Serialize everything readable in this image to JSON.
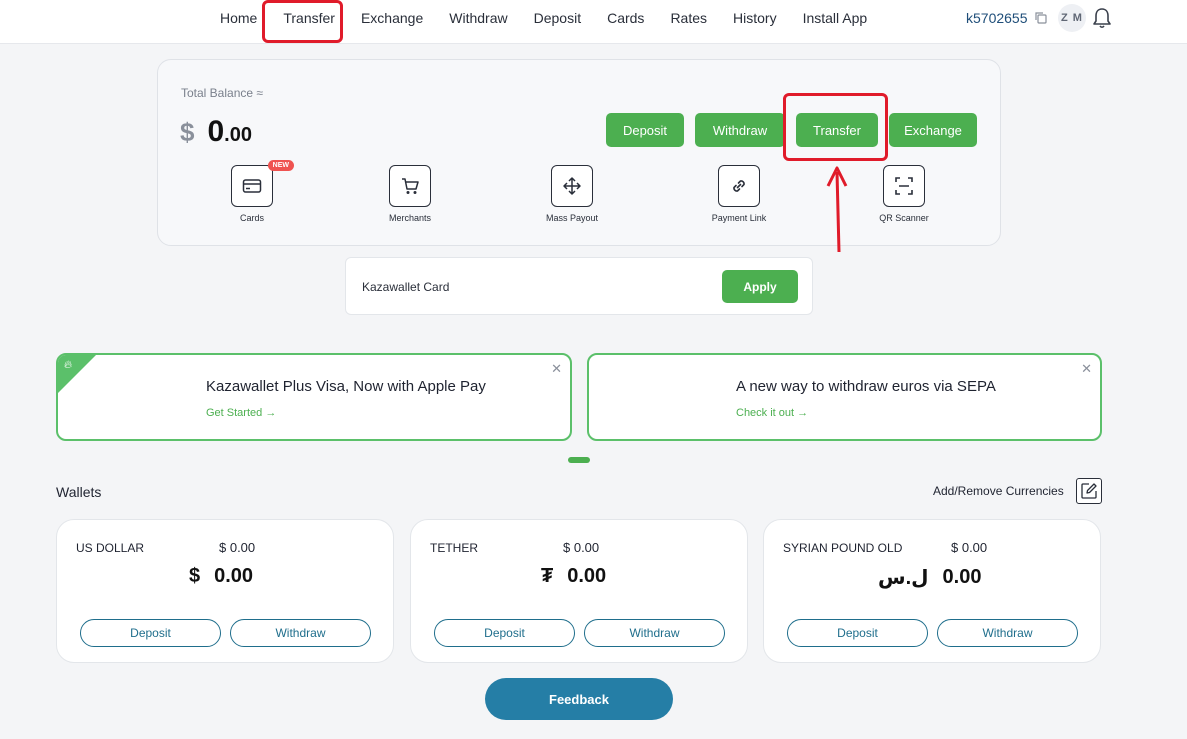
{
  "nav": {
    "items": [
      "Home",
      "Transfer",
      "Exchange",
      "Withdraw",
      "Deposit",
      "Cards",
      "Rates",
      "History",
      "Install App"
    ],
    "account_id": "k5702655",
    "avatar_initials": "Z M"
  },
  "balance": {
    "label": "Total Balance ≈",
    "currency_symbol": "$",
    "amount_int": "0",
    "amount_dec": ".00",
    "actions": [
      "Deposit",
      "Withdraw",
      "Transfer",
      "Exchange"
    ]
  },
  "quick_actions": [
    {
      "label": "Cards",
      "badge": "NEW",
      "icon": "credit-card-icon"
    },
    {
      "label": "Merchants",
      "icon": "cart-icon"
    },
    {
      "label": "Mass Payout",
      "icon": "move-arrows-icon"
    },
    {
      "label": "Payment Link",
      "icon": "link-icon"
    },
    {
      "label": "QR Scanner",
      "icon": "scan-icon"
    }
  ],
  "card_apply": {
    "label": "Kazawallet Card",
    "button": "Apply"
  },
  "promos": [
    {
      "title": "Kazawallet Plus Visa, Now with Apple Pay",
      "link": "Get Started",
      "icon": "flame-icon"
    },
    {
      "title": "A new way to withdraw euros via SEPA",
      "link": "Check it out"
    }
  ],
  "wallets": {
    "title": "Wallets",
    "add_remove": "Add/Remove Currencies",
    "items": [
      {
        "name": "US DOLLAR",
        "small": "$ 0.00",
        "symbol": "$",
        "amount": "0.00",
        "deposit": "Deposit",
        "withdraw": "Withdraw"
      },
      {
        "name": "TETHER",
        "small": "$ 0.00",
        "symbol": "₮",
        "amount": "0.00",
        "deposit": "Deposit",
        "withdraw": "Withdraw"
      },
      {
        "name": "SYRIAN POUND OLD",
        "small": "$ 0.00",
        "symbol": "ل.س",
        "amount": "0.00",
        "deposit": "Deposit",
        "withdraw": "Withdraw"
      }
    ]
  },
  "feedback": "Feedback",
  "colors": {
    "accent_green": "#4caf50",
    "feedback_blue": "#257ea6",
    "annotation_red": "#e01b2a"
  }
}
